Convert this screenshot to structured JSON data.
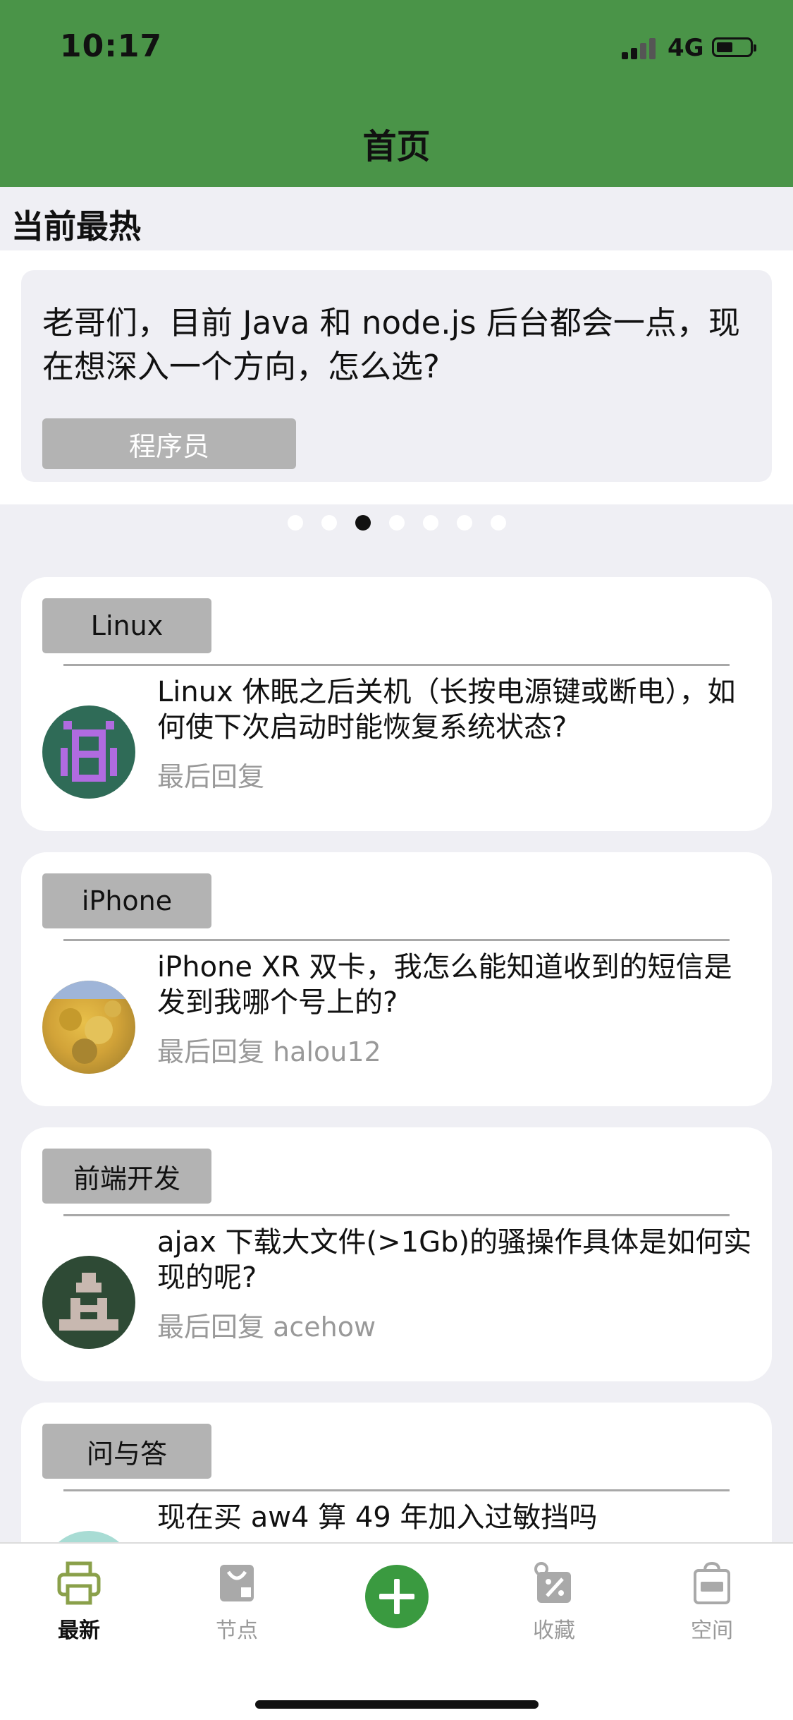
{
  "status": {
    "time": "10:17",
    "network": "4G"
  },
  "nav": {
    "title": "首页"
  },
  "section": {
    "title": "当前最热"
  },
  "hot": {
    "title": "老哥们，目前 Java 和 node.js 后台都会一点，现在想深入一个方向，怎么选?",
    "tag": "程序员",
    "dots_count": 7,
    "active_dot": 3
  },
  "topics": [
    {
      "node": "Linux",
      "title": "Linux 休眠之后关机（长按电源键或断电），如何使下次启动时能恢复系统状态?",
      "reply": "最后回复"
    },
    {
      "node": "iPhone",
      "title": "iPhone XR 双卡，我怎么能知道收到的短信是发到我哪个号上的?",
      "reply": "最后回复 halou12"
    },
    {
      "node": "前端开发",
      "title": "ajax 下载大文件(>1Gb)的骚操作具体是如何实现的呢?",
      "reply": "最后回复 acehow"
    },
    {
      "node": "问与答",
      "title": "现在买 aw4 算 49 年加入过敏挡吗",
      "reply": ""
    }
  ],
  "tabs": [
    {
      "label": "最新",
      "icon": "printer-icon",
      "active": true
    },
    {
      "label": "节点",
      "icon": "bag-icon",
      "active": false
    },
    {
      "label": "收藏",
      "icon": "coupon-icon",
      "active": false
    },
    {
      "label": "空间",
      "icon": "sale-bag-icon",
      "active": false
    }
  ],
  "colors": {
    "nav_green": "#4a9448",
    "active_tab": "#8aa04a",
    "add_button": "#3a9a40"
  }
}
